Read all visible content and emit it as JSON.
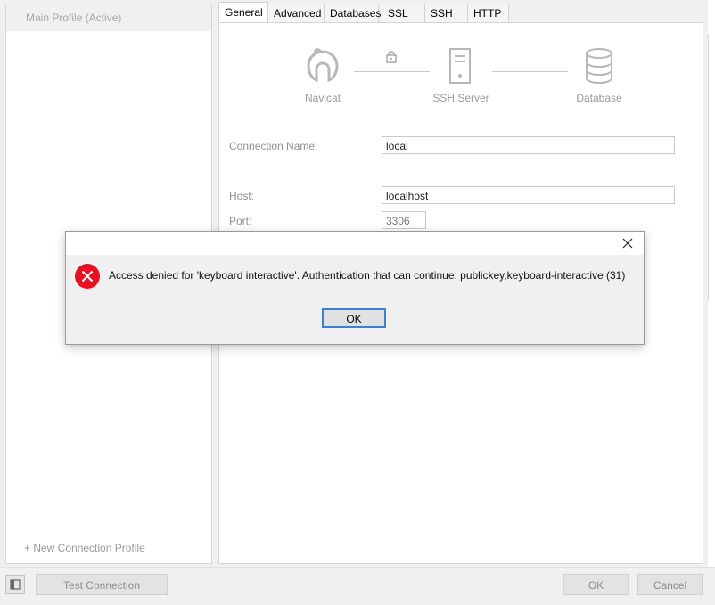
{
  "sidebar": {
    "active_profile": "Main Profile (Active)",
    "new_profile": "+ New Connection Profile"
  },
  "tabs": [
    {
      "label": "General"
    },
    {
      "label": "Advanced"
    },
    {
      "label": "Databases"
    },
    {
      "label": "SSL"
    },
    {
      "label": "SSH"
    },
    {
      "label": "HTTP"
    }
  ],
  "diagram": {
    "navicat": "Navicat",
    "ssh_server": "SSH Server",
    "database": "Database"
  },
  "form": {
    "connection_name_label": "Connection Name:",
    "connection_name_value": "local",
    "host_label": "Host:",
    "host_value": "localhost",
    "port_label": "Port:",
    "port_value": "3306"
  },
  "dialog": {
    "message": "Access denied for 'keyboard interactive'. Authentication that can continue: publickey,keyboard-interactive (31)",
    "ok_label": "OK"
  },
  "bottom": {
    "test_connection": "Test Connection",
    "ok": "OK",
    "cancel": "Cancel"
  },
  "colors": {
    "error_red": "#e81123",
    "accent_blue": "#3c80d6"
  }
}
